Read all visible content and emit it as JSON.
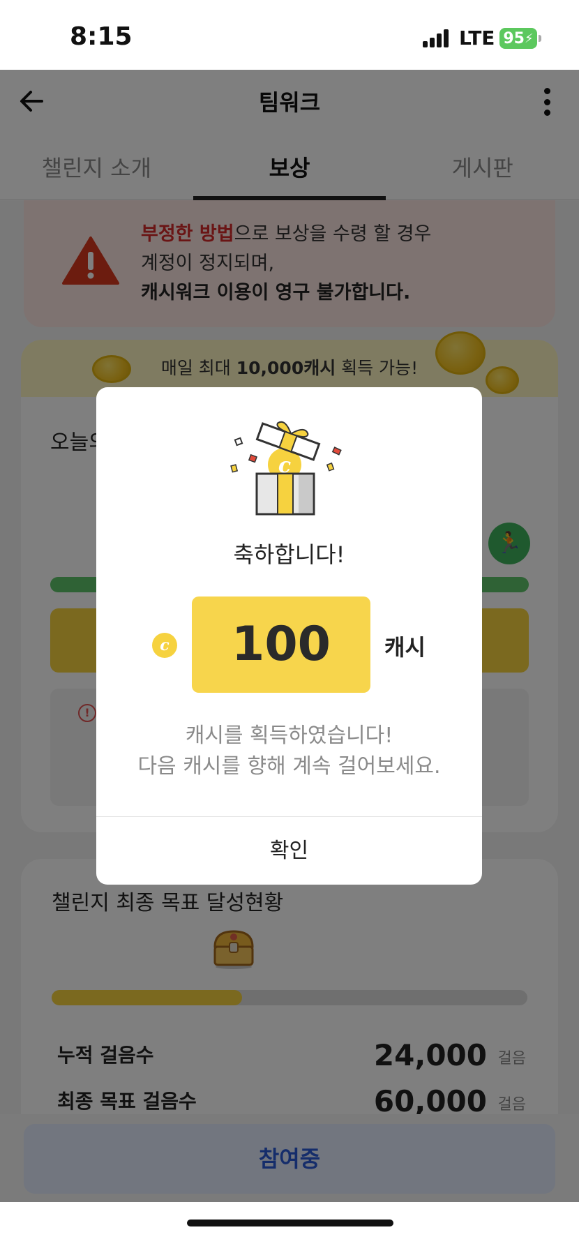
{
  "status_bar": {
    "time": "8:15",
    "network": "LTE",
    "battery": "95"
  },
  "header": {
    "title": "팀워크"
  },
  "tabs": [
    {
      "label": "챌린지 소개",
      "active": false
    },
    {
      "label": "보상",
      "active": true
    },
    {
      "label": "게시판",
      "active": false
    }
  ],
  "warning": {
    "highlight": "부정한 방법",
    "line1_rest": "으로 보상을 수령 할 경우",
    "line2": "계정이 정지되며,",
    "line3": "캐시워크 이용이 영구 불가합니다."
  },
  "reward_card": {
    "banner_prefix": "매일 최대 ",
    "banner_bold": "10,000캐시",
    "banner_suffix": " 획득 가능!",
    "today_label": "오늘의"
  },
  "goal_card": {
    "title": "챌린지 최종 목표 달성현황",
    "progress_fraction": 0.4,
    "stats": [
      {
        "label": "누적 걸음수",
        "value": "24,000",
        "unit": "걸음"
      },
      {
        "label": "최종 목표 걸음수",
        "value": "60,000",
        "unit": "걸음"
      }
    ]
  },
  "bottom": {
    "join_label": "참여중"
  },
  "modal": {
    "title": "축하합니다!",
    "coin_symbol": "c",
    "amount": "100",
    "unit": "캐시",
    "message_line1": "캐시를 획득하였습니다!",
    "message_line2": "다음 캐시를 향해 계속 걸어보세요.",
    "confirm_label": "확인"
  },
  "colors": {
    "accent_yellow": "#f6d23f",
    "warning_red": "#d52a2a",
    "join_blue": "#2b5bd7",
    "progress_green": "#5fc46b"
  }
}
